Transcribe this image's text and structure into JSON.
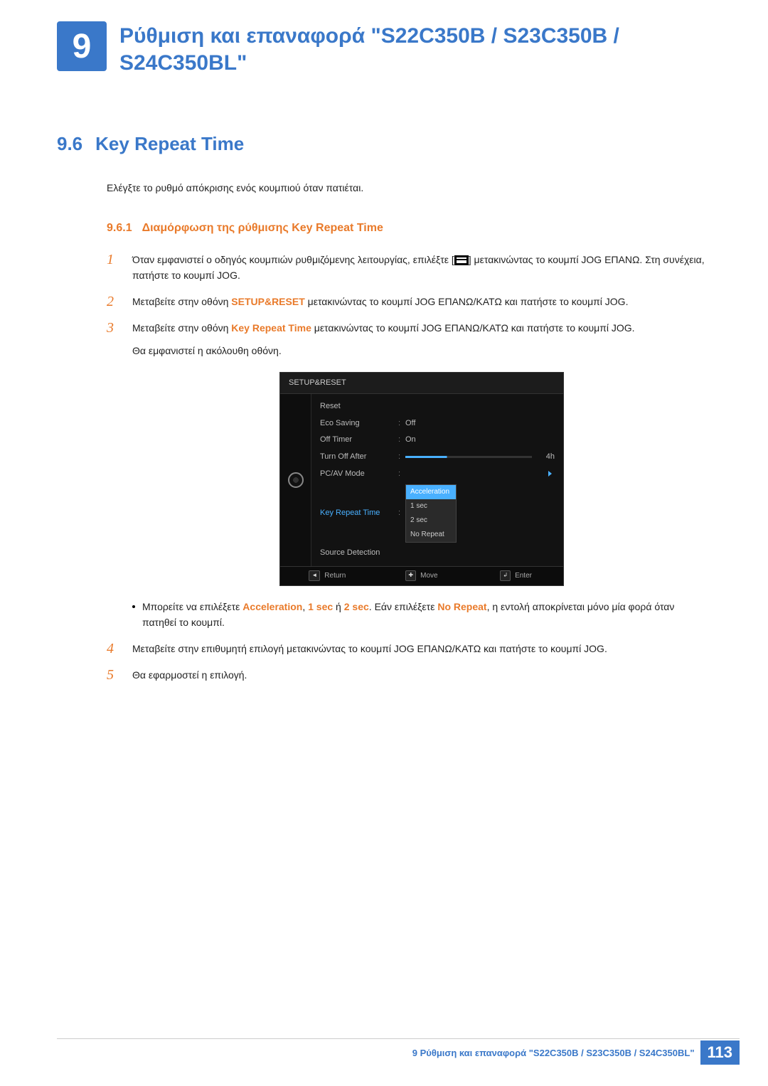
{
  "chapter": {
    "number": "9",
    "title": "Ρύθμιση και επαναφορά \"S22C350B / S23C350B / S24C350BL\""
  },
  "section": {
    "number": "9.6",
    "title": "Key Repeat Time",
    "intro": "Ελέγξτε το ρυθμό απόκρισης ενός κουμπιού όταν πατιέται."
  },
  "subsection": {
    "number": "9.6.1",
    "title": "Διαμόρφωση της ρύθμισης Key Repeat Time"
  },
  "steps": {
    "s1_pre": "Όταν εμφανιστεί ο οδηγός κουμπιών ρυθμιζόμενης λειτουργίας, επιλέξτε [",
    "s1_post": "] μετακινώντας το κουμπί JOG ΕΠΑΝΩ. Στη συνέχεια, πατήστε το κουμπί JOG.",
    "s2_pre": "Μεταβείτε στην οθόνη ",
    "s2_bold": "SETUP&RESET",
    "s2_post": " μετακινώντας το κουμπί JOG ΕΠΑΝΩ/ΚΑΤΩ και πατήστε το κουμπί JOG.",
    "s3_pre": "Μεταβείτε στην οθόνη ",
    "s3_bold": "Key Repeat Time",
    "s3_post": " μετακινώντας το κουμπί JOG ΕΠΑΝΩ/ΚΑΤΩ και πατήστε το κουμπί JOG.",
    "s3_note": "Θα εμφανιστεί η ακόλουθη οθόνη.",
    "bullet_pre": "Μπορείτε να επιλέξετε ",
    "bullet_b1": "Acceleration",
    "bullet_sep1": ", ",
    "bullet_b2": "1 sec",
    "bullet_sep2": " ή ",
    "bullet_b3": "2 sec",
    "bullet_mid": ". Εάν επιλέξετε ",
    "bullet_b4": "No Repeat",
    "bullet_post": ", η εντολή αποκρίνεται μόνο μία φορά όταν πατηθεί το κουμπί.",
    "s4": "Μεταβείτε στην επιθυμητή επιλογή μετακινώντας το κουμπί JOG ΕΠΑΝΩ/ΚΑΤΩ και πατήστε το κουμπί JOG.",
    "s5": "Θα εφαρμοστεί η επιλογή."
  },
  "step_numbers": {
    "n1": "1",
    "n2": "2",
    "n3": "3",
    "n4": "4",
    "n5": "5"
  },
  "osd": {
    "title": "SETUP&RESET",
    "rows": {
      "reset": "Reset",
      "eco": "Eco Saving",
      "eco_val": "Off",
      "offtimer": "Off Timer",
      "offtimer_val": "On",
      "turnoff": "Turn Off After",
      "turnoff_val": "4h",
      "pcav": "PC/AV Mode",
      "krt": "Key Repeat Time",
      "src": "Source Detection"
    },
    "options": {
      "o1": "Acceleration",
      "o2": "1 sec",
      "o3": "2 sec",
      "o4": "No Repeat"
    },
    "footer": {
      "return_key": "◄",
      "return": "Return",
      "move_key": "✚",
      "move": "Move",
      "enter_key": "↲",
      "enter": "Enter"
    },
    "colon": ":"
  },
  "footer": {
    "text": "9 Ρύθμιση και επαναφορά \"S22C350B / S23C350B / S24C350BL\"",
    "page": "113"
  }
}
